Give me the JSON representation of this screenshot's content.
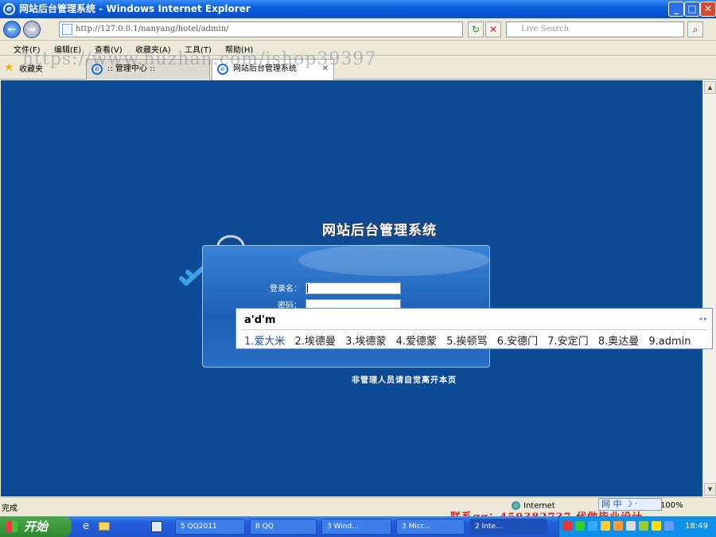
{
  "window": {
    "title": "网站后台管理系统 - Windows Internet Explorer",
    "ie_glyph": "e"
  },
  "controls": {
    "minimize": "_",
    "maximize": "□",
    "close": "✕"
  },
  "nav": {
    "address": "http://127.0.0.1/nanyang/hotel/admin/",
    "search_placeholder": "Live Search",
    "back": "←",
    "forward": "→",
    "refresh": "↻",
    "stop": "✕",
    "go": "⌕"
  },
  "menu": [
    "文件(F)",
    "编辑(E)",
    "查看(V)",
    "收藏夹(A)",
    "工具(T)",
    "帮助(H)"
  ],
  "tabs": {
    "favorites": "收藏夹",
    "items": [
      ":: 管理中心 ::",
      "网站后台管理系统"
    ],
    "close": "✕"
  },
  "watermark": "https://www.huzhan.com/ishop39397",
  "page": {
    "app_title": "网站后台管理系统",
    "username_label": "登录名：",
    "password_label": "密码：",
    "notice": "非管理人员请自觉离开本页"
  },
  "ime": {
    "composition": "a'd'm",
    "pager": "◂ ▸",
    "candidates": [
      "1.爱大米",
      "2.埃德曼",
      "3.埃德蒙",
      "4.爱德蒙",
      "5.挨顿骂",
      "6.安德门",
      "7.安定门",
      "8.奥达曼",
      "9.admin"
    ]
  },
  "status": {
    "text": "完成",
    "zone": "Internet",
    "zoom": "100%",
    "ime_bar": "网 中 ☽ ⸱"
  },
  "promo": "联系qq：459382737 代做毕业设计",
  "taskbar": {
    "start": "开始",
    "buttons": [
      "5 QQ2011",
      "8 QQ",
      "3 Wind...",
      "3 Micr...",
      "2 Inte..."
    ],
    "clock": "18:49"
  }
}
